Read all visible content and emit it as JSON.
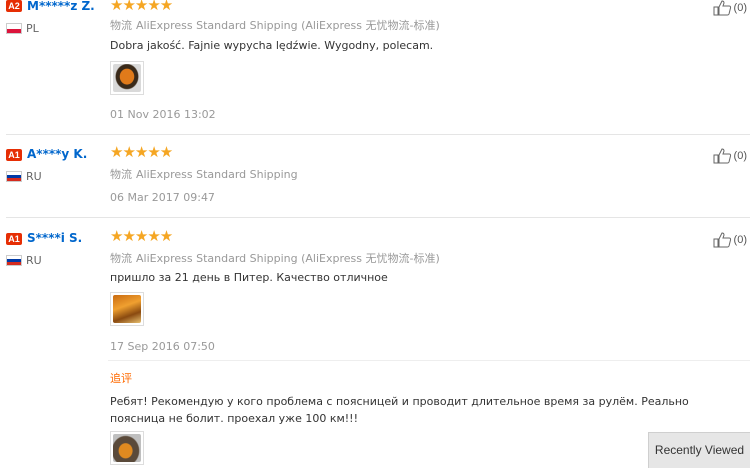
{
  "reviews": [
    {
      "level": "A2",
      "user": "M*****z Z.",
      "country": "PL",
      "stars": "★★★★★",
      "shipping_prefix": "物流",
      "shipping": "AliExpress Standard Shipping (AliExpress 无忧物流-标准)",
      "text": "Dobra jakość. Fajnie wypycha lędźwie. Wygodny, polecam.",
      "date": "01 Nov 2016 13:02",
      "likes": "(0)"
    },
    {
      "level": "A1",
      "user": "A****y K.",
      "country": "RU",
      "stars": "★★★★★",
      "shipping_prefix": "物流",
      "shipping": "AliExpress Standard Shipping",
      "date": "06 Mar 2017 09:47",
      "likes": "(0)"
    },
    {
      "level": "A1",
      "user": "S****i S.",
      "country": "RU",
      "stars": "★★★★★",
      "shipping_prefix": "物流",
      "shipping": "AliExpress Standard Shipping (AliExpress 无忧物流-标准)",
      "text": "пришло за 21 день в Питер. Качество отличное",
      "date": "17 Sep 2016 07:50",
      "likes": "(0)",
      "followup_label": "追评",
      "followup_text": "Ребят! Рекомендую у кого проблема с поясницей и проводит длительное время за рулём. Реально поясница не болит. проехал уже 100 км!!!"
    }
  ],
  "footer": {
    "recently_viewed": "Recently Viewed"
  },
  "colors": {
    "badge": "#e62e04",
    "link": "#0066cc",
    "star": "#f5a623",
    "followup": "#ff6a00"
  }
}
